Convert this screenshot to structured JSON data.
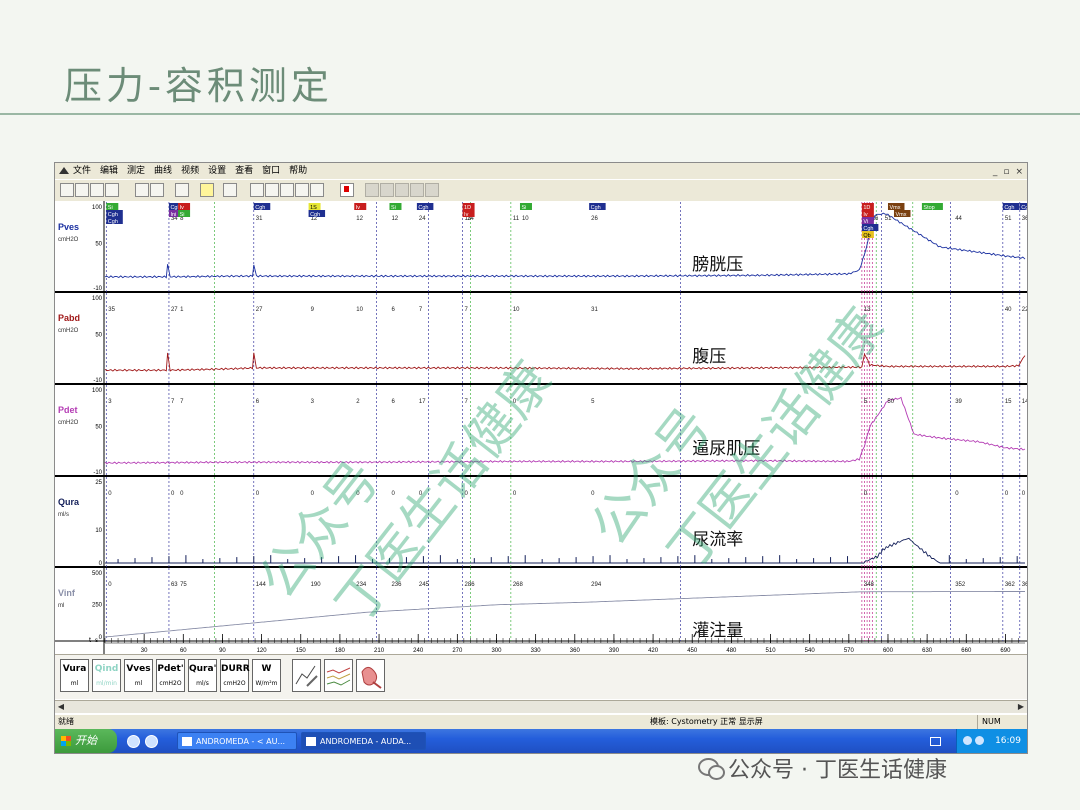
{
  "slide": {
    "title": "压力-容积测定"
  },
  "app": {
    "menu": [
      "文件",
      "编辑",
      "测定",
      "曲线",
      "视频",
      "设置",
      "查看",
      "窗口",
      "帮助"
    ],
    "window_controls": [
      "_",
      "▫",
      "×"
    ]
  },
  "params": [
    {
      "label": "Vura",
      "unit": "ml"
    },
    {
      "label": "Qind",
      "unit": "ml/min"
    },
    {
      "label": "Vves",
      "unit": "ml"
    },
    {
      "label": "Pdet'",
      "unit": "cmH2O"
    },
    {
      "label": "Qura'",
      "unit": "ml/s"
    },
    {
      "label": "DURR",
      "unit": "cmH2O"
    },
    {
      "label": "W",
      "unit": "W/m²m"
    }
  ],
  "status": {
    "ready": "就绪",
    "mode": "模板: Cystometry 正常 显示屏",
    "num": "NUM"
  },
  "taskbar": {
    "start": "开始",
    "items": [
      "ANDROMEDA - < AU...",
      "ANDROMEDA - AUDA..."
    ],
    "clock": "16:09"
  },
  "watermarks": [
    {
      "line1": "公众号",
      "line2": "丁医生话健康"
    },
    {
      "line1": "公众号",
      "line2": "丁医生话健康"
    }
  ],
  "footer_watermark": "公众号 · 丁医生话健康",
  "chart_data": {
    "type": "line",
    "time_axis": {
      "unit": "s",
      "ticks": [
        30,
        60,
        90,
        120,
        150,
        180,
        210,
        240,
        270,
        300,
        330,
        360,
        390,
        420,
        450,
        480,
        510,
        540,
        570,
        600,
        630,
        660,
        690
      ],
      "range": [
        0,
        705
      ]
    },
    "marker_times": [
      1,
      49,
      84,
      114,
      208,
      248,
      274,
      280,
      311,
      441,
      580,
      582,
      584,
      586,
      588,
      591,
      595,
      619,
      648,
      688,
      701
    ],
    "event_tags": [
      {
        "t": 1,
        "labels": [
          "Si",
          "Cgh",
          "Cgh"
        ]
      },
      {
        "t": 49,
        "labels": [
          "Cgh",
          "Ini"
        ]
      },
      {
        "t": 56,
        "labels": [
          "Iv",
          "Si"
        ]
      },
      {
        "t": 114,
        "labels": [
          "Cgh"
        ]
      },
      {
        "t": 156,
        "labels": [
          "1S",
          "Cgh"
        ]
      },
      {
        "t": 191,
        "labels": [
          "Iv"
        ]
      },
      {
        "t": 218,
        "labels": [
          "Si"
        ]
      },
      {
        "t": 239,
        "labels": [
          "Cgh"
        ]
      },
      {
        "t": 274,
        "labels": [
          "1D",
          "Iv"
        ]
      },
      {
        "t": 318,
        "labels": [
          "Si"
        ]
      },
      {
        "t": 371,
        "labels": [
          "Cgh"
        ]
      },
      {
        "t": 580,
        "labels": [
          "1D",
          "Iv",
          "Vi",
          "Cgh",
          "Qb"
        ]
      },
      {
        "t": 600,
        "labels": [
          "Vmx",
          "Vmx"
        ]
      },
      {
        "t": 626,
        "labels": [
          "Stop"
        ]
      },
      {
        "t": 688,
        "labels": [
          "Cgh"
        ]
      },
      {
        "t": 701,
        "labels": [
          "Cgh"
        ]
      }
    ],
    "channels": [
      {
        "name": "Pves",
        "unit": "cmH2O",
        "ymin": -10,
        "ymax": 100,
        "color": "#1a2fa0",
        "annotation": "膀胱压",
        "x": [
          0,
          47,
          48,
          50,
          100,
          113,
          114,
          116,
          200,
          300,
          400,
          500,
          570,
          578,
          582,
          585,
          590,
          598,
          600,
          640,
          690,
          700,
          705
        ],
        "y": [
          5,
          5,
          22,
          5,
          6,
          6,
          22,
          6,
          6,
          6,
          6,
          7,
          9,
          14,
          35,
          55,
          88,
          90,
          88,
          45,
          33,
          31,
          30
        ],
        "values": [
          {
            "t": 1,
            "text": "37"
          },
          {
            "t": 49,
            "text": "34"
          },
          {
            "t": 56,
            "text": "8"
          },
          {
            "t": 114,
            "text": "31"
          },
          {
            "t": 156,
            "text": "12"
          },
          {
            "t": 191,
            "text": "12"
          },
          {
            "t": 218,
            "text": "12"
          },
          {
            "t": 239,
            "text": "24"
          },
          {
            "t": 274,
            "text": "13"
          },
          {
            "t": 276,
            "text": "14"
          },
          {
            "t": 311,
            "text": "11"
          },
          {
            "t": 318,
            "text": "10"
          },
          {
            "t": 371,
            "text": "26"
          },
          {
            "t": 580,
            "text": "16"
          },
          {
            "t": 586,
            "text": "16"
          },
          {
            "t": 596,
            "text": "51"
          },
          {
            "t": 650,
            "text": "44"
          },
          {
            "t": 688,
            "text": "51"
          },
          {
            "t": 701,
            "text": "36"
          }
        ]
      },
      {
        "name": "Pabd",
        "unit": "cmH2O",
        "ymin": -10,
        "ymax": 100,
        "color": "#a01818",
        "annotation": "腹压",
        "x": [
          0,
          47,
          48,
          50,
          100,
          113,
          114,
          116,
          200,
          300,
          400,
          500,
          570,
          580,
          582,
          586,
          600,
          640,
          690,
          700,
          705
        ],
        "y": [
          3,
          3,
          25,
          3,
          5,
          6,
          26,
          6,
          6,
          6,
          5,
          6,
          7,
          7,
          25,
          10,
          8,
          8,
          8,
          9,
          23
        ],
        "values": [
          {
            "t": 1,
            "text": "35"
          },
          {
            "t": 49,
            "text": "27"
          },
          {
            "t": 56,
            "text": "1"
          },
          {
            "t": 114,
            "text": "27"
          },
          {
            "t": 156,
            "text": "9"
          },
          {
            "t": 191,
            "text": "10"
          },
          {
            "t": 218,
            "text": "6"
          },
          {
            "t": 239,
            "text": "7"
          },
          {
            "t": 274,
            "text": "7"
          },
          {
            "t": 311,
            "text": "10"
          },
          {
            "t": 371,
            "text": "31"
          },
          {
            "t": 580,
            "text": "13"
          },
          {
            "t": 688,
            "text": "40"
          },
          {
            "t": 701,
            "text": "22"
          }
        ]
      },
      {
        "name": "Pdet",
        "unit": "cmH2O",
        "ymin": -10,
        "ymax": 100,
        "color": "#b43cb4",
        "annotation": "逼尿肌压",
        "x": [
          0,
          100,
          200,
          300,
          400,
          500,
          570,
          578,
          582,
          586,
          600,
          610,
          620,
          640,
          670,
          690,
          705
        ],
        "y": [
          2,
          3,
          3,
          4,
          4,
          5,
          4,
          7,
          25,
          50,
          85,
          88,
          40,
          35,
          30,
          22,
          20
        ],
        "values": [
          {
            "t": 1,
            "text": "3"
          },
          {
            "t": 49,
            "text": "7"
          },
          {
            "t": 56,
            "text": "7"
          },
          {
            "t": 114,
            "text": "6"
          },
          {
            "t": 156,
            "text": "3"
          },
          {
            "t": 191,
            "text": "2"
          },
          {
            "t": 218,
            "text": "6"
          },
          {
            "t": 239,
            "text": "17"
          },
          {
            "t": 274,
            "text": "7"
          },
          {
            "t": 311,
            "text": "0"
          },
          {
            "t": 371,
            "text": "5"
          },
          {
            "t": 580,
            "text": "5"
          },
          {
            "t": 598,
            "text": "50"
          },
          {
            "t": 650,
            "text": "39"
          },
          {
            "t": 688,
            "text": "15"
          },
          {
            "t": 701,
            "text": "14"
          }
        ]
      },
      {
        "name": "Qura",
        "unit": "ml/s",
        "ymin": 0,
        "ymax": 25,
        "color": "#14205a",
        "annotation": "尿流率",
        "x": [
          0,
          580,
          592,
          596,
          600,
          606,
          612,
          616,
          620,
          626,
          632,
          638,
          640,
          705
        ],
        "y": [
          0,
          0,
          2,
          4,
          5,
          6,
          7,
          7.5,
          6,
          4,
          2,
          0.5,
          0,
          0
        ],
        "values": [
          {
            "t": 1,
            "text": "0"
          },
          {
            "t": 49,
            "text": "0"
          },
          {
            "t": 56,
            "text": "0"
          },
          {
            "t": 114,
            "text": "0"
          },
          {
            "t": 156,
            "text": "0"
          },
          {
            "t": 191,
            "text": "0"
          },
          {
            "t": 218,
            "text": "0"
          },
          {
            "t": 239,
            "text": "0"
          },
          {
            "t": 274,
            "text": "0"
          },
          {
            "t": 311,
            "text": "0"
          },
          {
            "t": 371,
            "text": "0"
          },
          {
            "t": 580,
            "text": "0"
          },
          {
            "t": 650,
            "text": "0"
          },
          {
            "t": 688,
            "text": "0"
          },
          {
            "t": 701,
            "text": "0"
          }
        ]
      },
      {
        "name": "Vinf",
        "unit": "ml",
        "ymin": 0,
        "ymax": 500,
        "color": "#8a8fa8",
        "annotation": "灌注量",
        "x": [
          0,
          200,
          300,
          370,
          580,
          705
        ],
        "y": [
          0,
          190,
          248,
          268,
          348,
          350
        ],
        "values": [
          {
            "t": 1,
            "text": "0"
          },
          {
            "t": 49,
            "text": "63"
          },
          {
            "t": 56,
            "text": "75"
          },
          {
            "t": 114,
            "text": "144"
          },
          {
            "t": 156,
            "text": "190"
          },
          {
            "t": 191,
            "text": "234"
          },
          {
            "t": 218,
            "text": "236"
          },
          {
            "t": 239,
            "text": "245"
          },
          {
            "t": 274,
            "text": "286"
          },
          {
            "t": 311,
            "text": "268"
          },
          {
            "t": 371,
            "text": "294"
          },
          {
            "t": 580,
            "text": "348"
          },
          {
            "t": 650,
            "text": "352"
          },
          {
            "t": 688,
            "text": "362"
          },
          {
            "t": 701,
            "text": "365"
          }
        ]
      }
    ]
  }
}
